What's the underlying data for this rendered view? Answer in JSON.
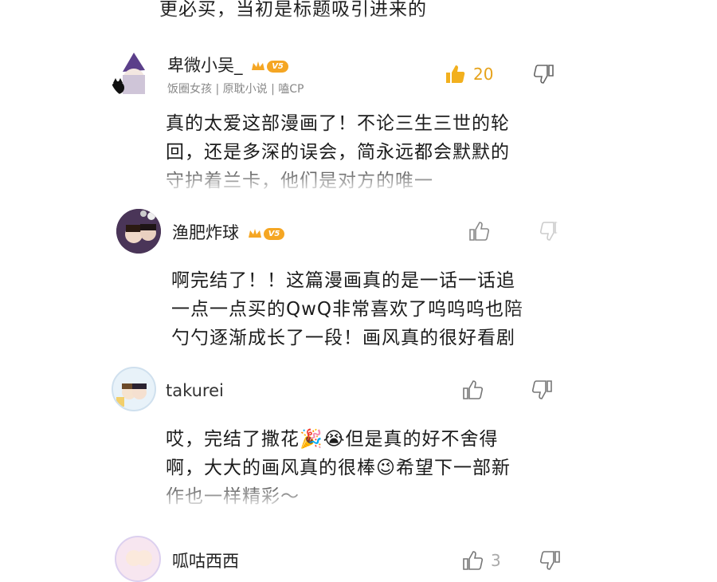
{
  "comments": [
    {
      "lines": [
        "更必买，当初是标题吸引进来的"
      ]
    },
    {
      "username": "卑微小吴_",
      "level": "V5",
      "tags": "饭圈女孩 | 原耽小说 | 嗑CP",
      "likes": "20",
      "lines": [
        "真的太爱这部漫画了！不论三生三世的轮",
        "回，还是多深的误会，简永远都会默默的",
        "守护着兰卡，他们是对方的唯一"
      ]
    },
    {
      "username": "渔肥炸球",
      "level": "V5",
      "lines": [
        "啊完结了！！这篇漫画真的是一话一话追",
        "一点一点买的QwQ非常喜欢了呜呜呜也陪",
        "勺勺逐渐成长了一段！画风真的很好看剧"
      ]
    },
    {
      "username": "takurei",
      "lines": [
        "哎，完结了撒花🎉😭但是真的好不舍得",
        "啊，大大的画风真的很棒😉希望下一部新",
        "作也一样精彩～"
      ]
    },
    {
      "username": "呱咕西西",
      "likes": "3"
    }
  ],
  "colors": {
    "accent": "#f5a623",
    "like_active": "#f2b01e",
    "text": "#1c1c1c",
    "muted": "#888888"
  },
  "icons": {
    "like": "thumbs-up-icon",
    "dislike": "thumbs-down-icon",
    "vip": "crown-icon"
  }
}
